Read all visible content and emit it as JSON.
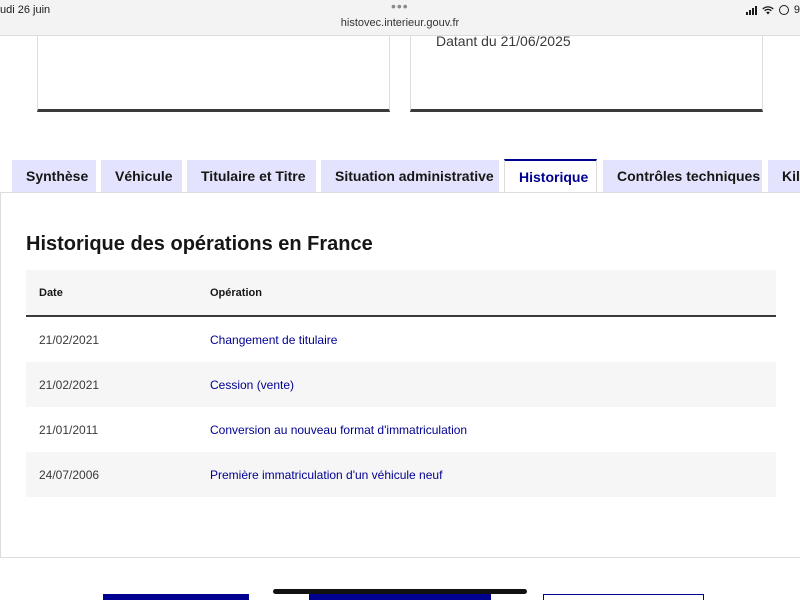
{
  "status_bar": {
    "time": "udi 26 juin",
    "url": "histovec.interieur.gouv.fr",
    "battery_text": "9"
  },
  "cards": {
    "right_date": "Datant du 21/06/2025"
  },
  "tabs": [
    {
      "label": "Synthèse",
      "active": false
    },
    {
      "label": "Véhicule",
      "active": false
    },
    {
      "label": "Titulaire et Titre",
      "active": false
    },
    {
      "label": "Situation administrative",
      "active": false
    },
    {
      "label": "Historique",
      "active": true
    },
    {
      "label": "Contrôles techniques",
      "active": false
    },
    {
      "label": "Kilo",
      "active": false
    }
  ],
  "panel": {
    "title": "Historique des opérations en France",
    "headers": {
      "date": "Date",
      "operation": "Opération"
    },
    "rows": [
      {
        "date": "21/02/2021",
        "operation": "Changement de titulaire"
      },
      {
        "date": "21/02/2021",
        "operation": "Cession (vente)"
      },
      {
        "date": "21/01/2011",
        "operation": "Conversion au nouveau format d'immatriculation"
      },
      {
        "date": "24/07/2006",
        "operation": "Première immatriculation d'un véhicule neuf"
      }
    ]
  },
  "colors": {
    "primary": "#000091",
    "tab_bg": "#e3e3fd",
    "row_alt": "#f6f6f6"
  }
}
